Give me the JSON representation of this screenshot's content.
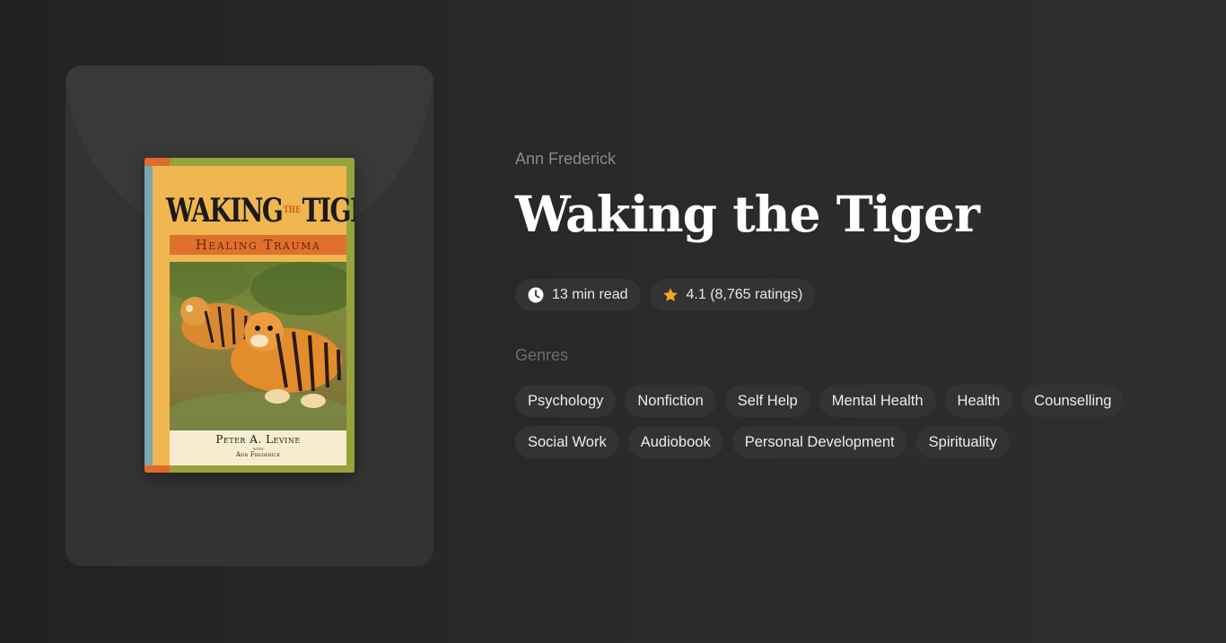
{
  "book": {
    "author": "Ann Frederick",
    "title": "Waking the Tiger",
    "cover": {
      "title_left": "WAKING",
      "title_the": "THE",
      "title_right": "TIGER",
      "subtitle": "Healing Trauma",
      "author": "Peter A. Levine",
      "with": "WITH",
      "coauthor": "Ann Frederick"
    }
  },
  "meta": {
    "read_time": "13 min read",
    "rating": "4.1 (8,765 ratings)",
    "read_time_icon": "clock-icon",
    "rating_icon": "star-icon",
    "star_color": "#f5a623"
  },
  "genres_label": "Genres",
  "genres": {
    "row1": [
      "Psychology",
      "Nonfiction",
      "Self Help",
      "Mental Health",
      "Health",
      "Counselling"
    ],
    "row2": [
      "Social Work",
      "Audiobook",
      "Personal Development",
      "Spirituality"
    ]
  }
}
